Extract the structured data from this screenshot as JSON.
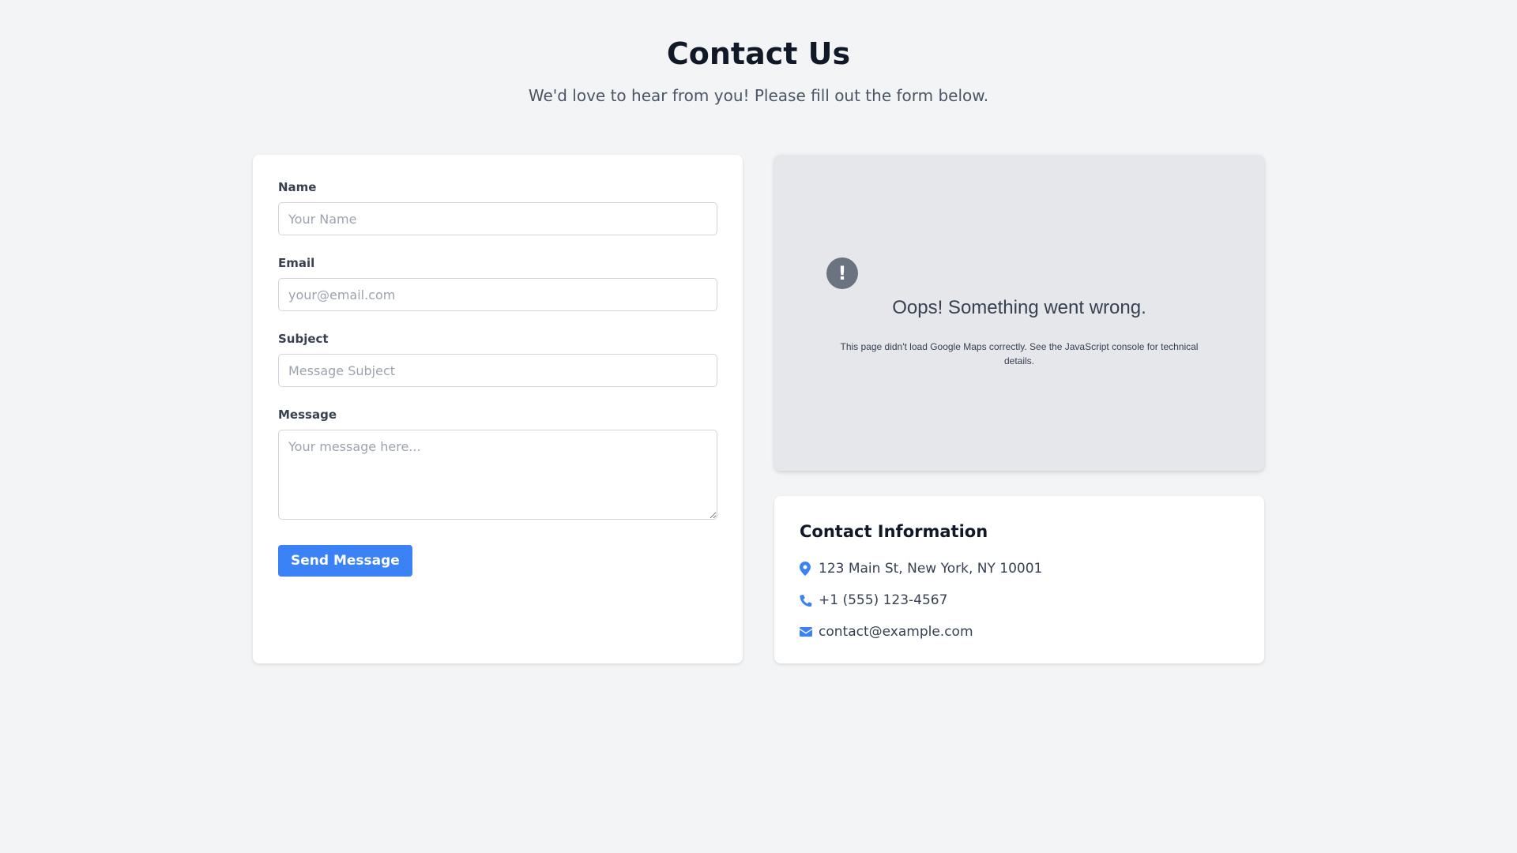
{
  "header": {
    "title": "Contact Us",
    "subtitle": "We'd love to hear from you! Please fill out the form below."
  },
  "form": {
    "name_label": "Name",
    "name_placeholder": "Your Name",
    "email_label": "Email",
    "email_placeholder": "your@email.com",
    "subject_label": "Subject",
    "subject_placeholder": "Message Subject",
    "message_label": "Message",
    "message_placeholder": "Your message here...",
    "submit_label": "Send Message"
  },
  "map": {
    "error_icon_glyph": "!",
    "error_title": "Oops! Something went wrong.",
    "error_details": "This page didn't load Google Maps correctly. See the JavaScript console for technical details."
  },
  "contact_info": {
    "title": "Contact Information",
    "address": "123 Main St, New York, NY 10001",
    "phone": "+1 (555) 123-4567",
    "email": "contact@example.com",
    "icons": [
      "map-pin-icon",
      "phone-icon",
      "envelope-icon"
    ]
  },
  "colors": {
    "accent": "#3b82f6",
    "background": "#f3f4f6",
    "map_placeholder": "#e5e7eb"
  }
}
